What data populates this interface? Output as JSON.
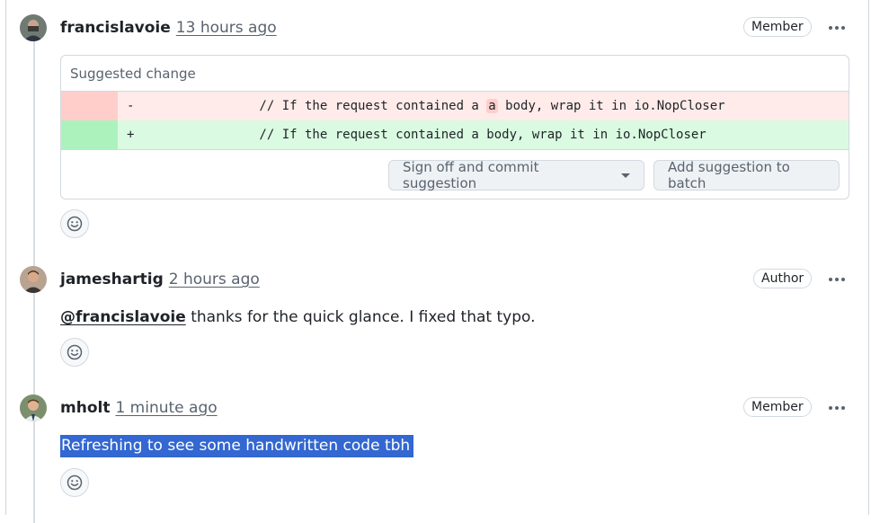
{
  "comments": [
    {
      "author": "francislavoie",
      "timestamp": "13 hours ago",
      "role": "Member",
      "suggestion": {
        "title": "Suggested change",
        "removed_marker": "-",
        "removed_before": "        // If the request contained a ",
        "removed_word": "a",
        "removed_after": " body, wrap it in io.NopCloser",
        "added_marker": "+",
        "added_line": "        // If the request contained a body, wrap it in io.NopCloser",
        "commit_button": "Sign off and commit suggestion",
        "batch_button": "Add suggestion to batch"
      }
    },
    {
      "author": "jameshartig",
      "timestamp": "2 hours ago",
      "role": "Author",
      "mention": "@francislavoie",
      "body": " thanks for the quick glance. I fixed that typo."
    },
    {
      "author": "mholt",
      "timestamp": "1 minute ago",
      "role": "Member",
      "body": "Refreshing to see some handwritten code tbh"
    }
  ],
  "icons": {
    "more": "kebab-horizontal-icon",
    "reaction": "smiley-icon",
    "dropdown": "triangle-down-icon"
  },
  "colors": {
    "deletion_bg": "#ffebe9",
    "addition_bg": "#dafbe1",
    "selection": "#3367d1"
  }
}
